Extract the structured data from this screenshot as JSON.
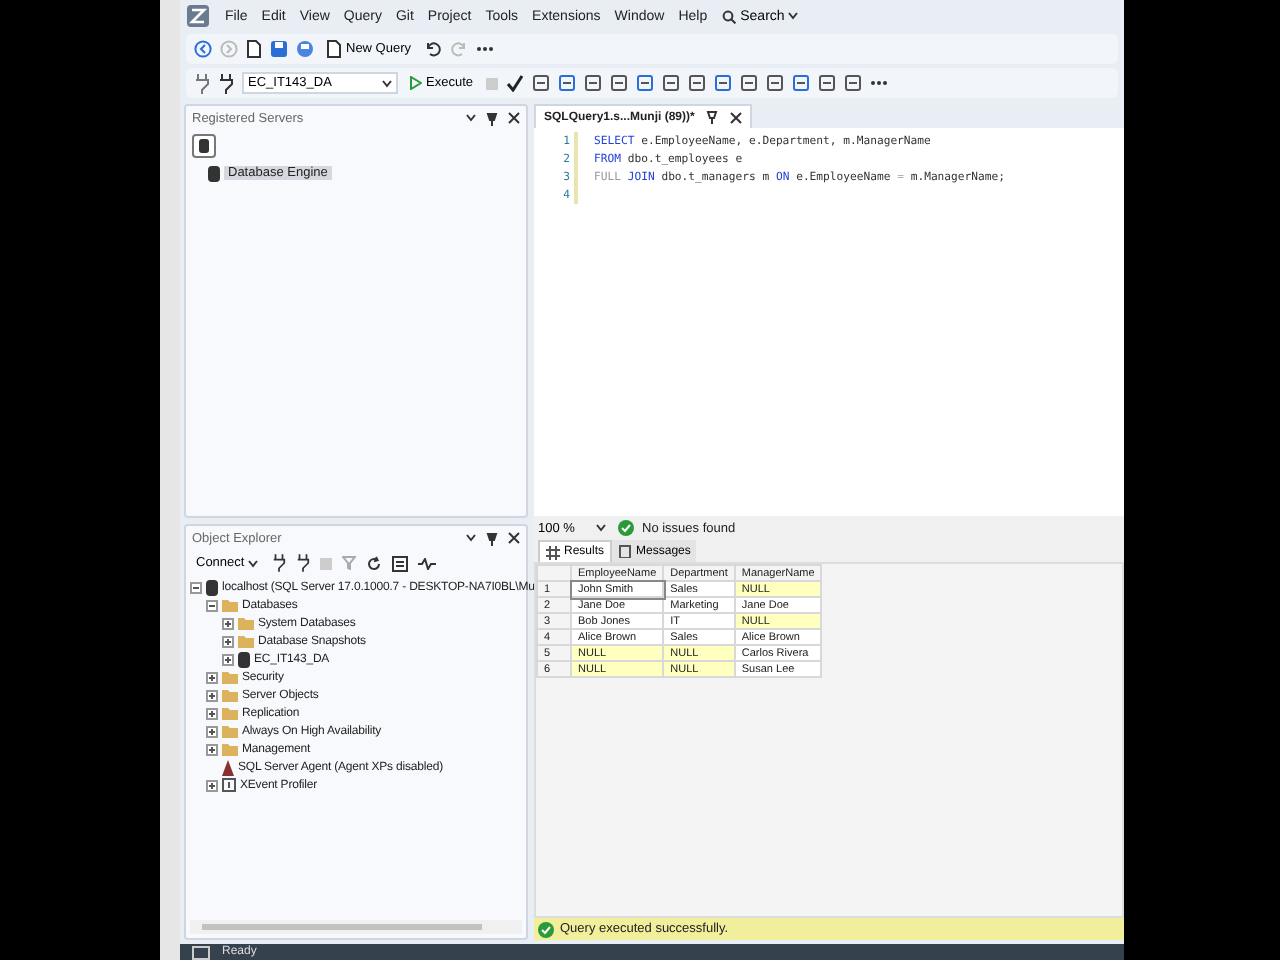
{
  "menu": {
    "items": [
      "File",
      "Edit",
      "View",
      "Query",
      "Git",
      "Project",
      "Tools",
      "Extensions",
      "Window",
      "Help"
    ],
    "search": "Search"
  },
  "toolbar": {
    "new_query": "New Query",
    "database": "EC_IT143_DA",
    "execute": "Execute"
  },
  "registered_servers": {
    "title": "Registered Servers",
    "items": [
      {
        "label": "Database Engine",
        "selected": true
      }
    ]
  },
  "editor": {
    "tab": "SQLQuery1.s...Munji (89))*",
    "lines": [
      {
        "number": "1",
        "segments": [
          {
            "kind": "keyword",
            "text": "SELECT"
          },
          {
            "kind": "plain",
            "text": " e.EmployeeName, e.Department, m.ManagerName"
          }
        ]
      },
      {
        "number": "2",
        "segments": [
          {
            "kind": "keyword",
            "text": "FROM"
          },
          {
            "kind": "plain",
            "text": " dbo.t_employees e"
          }
        ]
      },
      {
        "number": "3",
        "segments": [
          {
            "kind": "operator",
            "text": "FULL"
          },
          {
            "kind": "keyword",
            "text": " JOIN"
          },
          {
            "kind": "plain",
            "text": " dbo.t_managers m "
          },
          {
            "kind": "keyword",
            "text": "ON"
          },
          {
            "kind": "plain",
            "text": " e.EmployeeName "
          },
          {
            "kind": "operator",
            "text": "="
          },
          {
            "kind": "plain",
            "text": " m.ManagerName;"
          }
        ]
      },
      {
        "number": "4"
      }
    ],
    "zoom": "100 %",
    "issues": "No issues found"
  },
  "results": {
    "tabs": [
      {
        "label": "Results",
        "selected": true
      },
      {
        "label": "Messages",
        "selected": false
      }
    ],
    "columns": [
      "EmployeeName",
      "Department",
      "ManagerName"
    ],
    "rows": [
      {
        "number": "1",
        "cells": [
          {
            "text": "John Smith",
            "highlighted": false
          },
          {
            "text": "Sales",
            "highlighted": false
          },
          {
            "text": "NULL",
            "highlighted": true
          }
        ]
      },
      {
        "number": "2",
        "cells": [
          {
            "text": "Jane Doe",
            "highlighted": false
          },
          {
            "text": "Marketing",
            "highlighted": false
          },
          {
            "text": "Jane Doe",
            "highlighted": false
          }
        ]
      },
      {
        "number": "3",
        "cells": [
          {
            "text": "Bob Jones",
            "highlighted": false
          },
          {
            "text": "IT",
            "highlighted": false
          },
          {
            "text": "NULL",
            "highlighted": true
          }
        ]
      },
      {
        "number": "4",
        "cells": [
          {
            "text": "Alice Brown",
            "highlighted": false
          },
          {
            "text": "Sales",
            "highlighted": false
          },
          {
            "text": "Alice Brown",
            "highlighted": false
          }
        ]
      },
      {
        "number": "5",
        "cells": [
          {
            "text": "NULL",
            "highlighted": true
          },
          {
            "text": "NULL",
            "highlighted": true
          },
          {
            "text": "Carlos Rivera",
            "highlighted": false
          }
        ]
      },
      {
        "number": "6",
        "cells": [
          {
            "text": "NULL",
            "highlighted": true
          },
          {
            "text": "NULL",
            "highlighted": true
          },
          {
            "text": "Susan Lee",
            "highlighted": false
          }
        ]
      }
    ],
    "message": "Query executed successfully."
  },
  "object_explorer": {
    "title": "Object Explorer",
    "connect": "Connect",
    "tree": [
      {
        "label": "localhost (SQL Server 17.0.1000.7 - DESKTOP-NA7I0BL\\Mu",
        "kind": "server",
        "expanded": true,
        "children": [
          {
            "label": "Databases",
            "kind": "folder",
            "expanded": true,
            "children": [
              {
                "label": "System Databases",
                "kind": "folder",
                "expanded": false
              },
              {
                "label": "Database Snapshots",
                "kind": "folder",
                "expanded": false
              },
              {
                "label": "EC_IT143_DA",
                "kind": "database",
                "expanded": false
              }
            ]
          },
          {
            "label": "Security",
            "kind": "folder",
            "expanded": false
          },
          {
            "label": "Server Objects",
            "kind": "folder",
            "expanded": false
          },
          {
            "label": "Replication",
            "kind": "folder",
            "expanded": false
          },
          {
            "label": "Always On High Availability",
            "kind": "folder",
            "expanded": false
          },
          {
            "label": "Management",
            "kind": "folder",
            "expanded": false
          },
          {
            "label": "SQL Server Agent (Agent XPs disabled)",
            "kind": "agent"
          },
          {
            "label": "XEvent Profiler",
            "kind": "profiler",
            "expanded": false
          }
        ]
      }
    ]
  },
  "status_bar": {
    "text": "Ready"
  }
}
